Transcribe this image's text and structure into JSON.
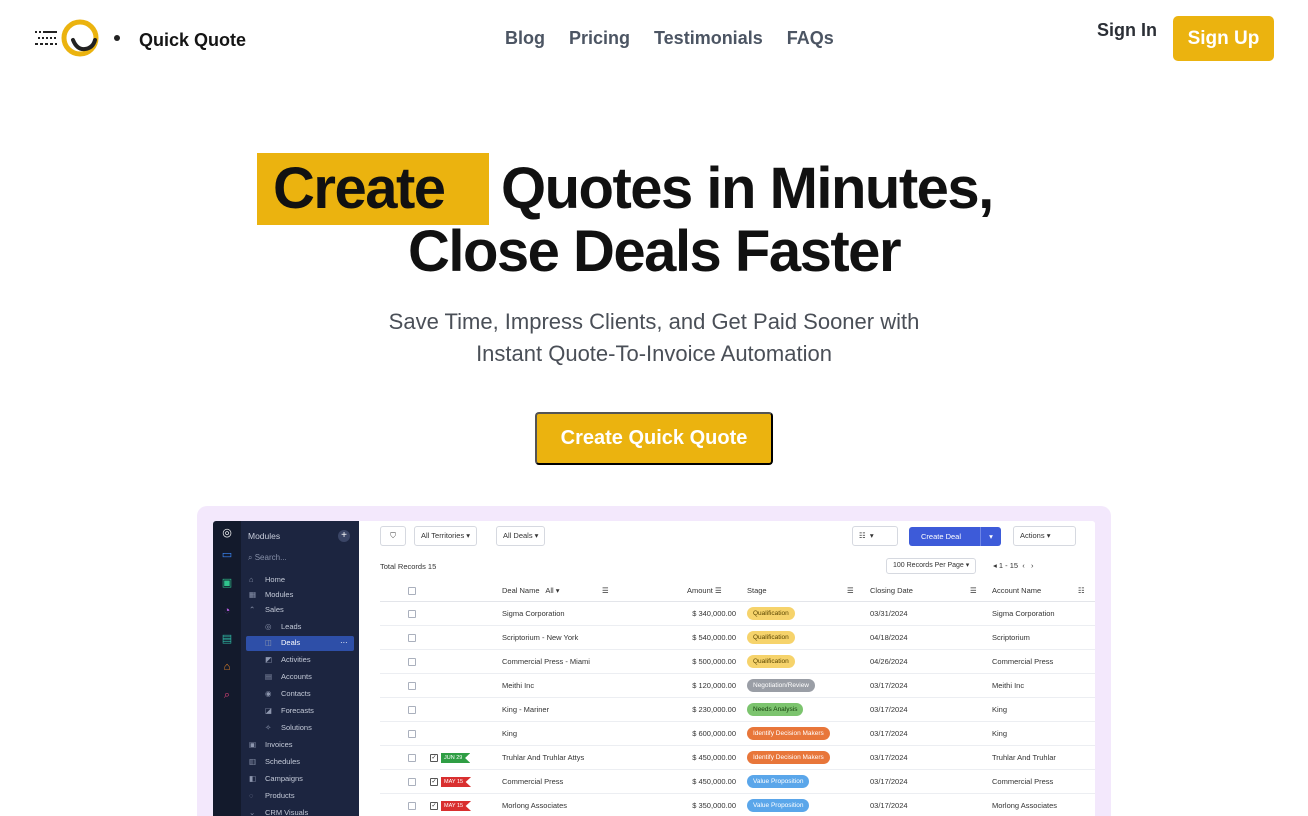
{
  "brand": {
    "name": "Quick Quote",
    "accent": "#ebb30f"
  },
  "nav": {
    "links": [
      "Blog",
      "Pricing",
      "Testimonials",
      "FAQs"
    ],
    "sign_in": "Sign In",
    "sign_up": "Sign Up"
  },
  "hero": {
    "highlight": "Create",
    "line1_rest": "Quotes in Minutes,",
    "line2": "Close Deals Faster",
    "subtitle_1": "Save Time, Impress Clients, and Get Paid Sooner with",
    "subtitle_2": "Instant Quote-To-Invoice Automation",
    "cta": "Create Quick Quote"
  },
  "app": {
    "sidebar": {
      "header": "Modules",
      "search": "Search...",
      "items": [
        {
          "icon": "home-icon",
          "glyph": "⌂",
          "label": "Home",
          "sub": false
        },
        {
          "icon": "modules-icon",
          "glyph": "▦",
          "label": "Modules",
          "sub": false
        },
        {
          "icon": "sales-icon",
          "glyph": "⌃",
          "label": "Sales",
          "sub": false
        },
        {
          "icon": "leads-icon",
          "glyph": "◎",
          "label": "Leads",
          "sub": true
        },
        {
          "icon": "deals-icon",
          "glyph": "◫",
          "label": "Deals",
          "sub": true
        },
        {
          "icon": "activities-icon",
          "glyph": "◩",
          "label": "Activities",
          "sub": true
        },
        {
          "icon": "accounts-icon",
          "glyph": "▤",
          "label": "Accounts",
          "sub": true
        },
        {
          "icon": "contacts-icon",
          "glyph": "◉",
          "label": "Contacts",
          "sub": true
        },
        {
          "icon": "forecasts-icon",
          "glyph": "◪",
          "label": "Forecasts",
          "sub": true
        },
        {
          "icon": "solutions-icon",
          "glyph": "✧",
          "label": "Solutions",
          "sub": true
        },
        {
          "icon": "invoices-icon",
          "glyph": "▣",
          "label": "Invoices",
          "sub": false
        },
        {
          "icon": "schedules-icon",
          "glyph": "▥",
          "label": "Schedules",
          "sub": false
        },
        {
          "icon": "campaigns-icon",
          "glyph": "◧",
          "label": "Campaigns",
          "sub": false
        },
        {
          "icon": "products-icon",
          "glyph": "◌",
          "label": "Products",
          "sub": false
        },
        {
          "icon": "crm-visuals-icon",
          "glyph": "⌄",
          "label": "CRM Visuals",
          "sub": false
        }
      ]
    },
    "toolbar": {
      "filter_icon": "filter-icon",
      "territories": "All Territories",
      "deals_filter": "All Deals",
      "create_deal": "Create Deal",
      "actions": "Actions"
    },
    "total_records": "Total Records 15",
    "per_page": "100 Records Per Page",
    "page_info": "1 - 15",
    "columns": {
      "deal_name": "Deal Name",
      "deal_filter": "All",
      "amount": "Amount",
      "stage": "Stage",
      "closing_date": "Closing Date",
      "account_name": "Account Name"
    },
    "rows": [
      {
        "deal": "Sigma Corporation",
        "amount": "$ 340,000.00",
        "stage": "Qualification",
        "stage_bg": "#f6d36b",
        "stage_fg": "#5a4500",
        "date": "03/31/2024",
        "account": "Sigma Corporation",
        "flag": "",
        "flag_color": ""
      },
      {
        "deal": "Scriptorium - New York",
        "amount": "$ 540,000.00",
        "stage": "Qualification",
        "stage_bg": "#f6d36b",
        "stage_fg": "#5a4500",
        "date": "04/18/2024",
        "account": "Scriptorium",
        "flag": "",
        "flag_color": ""
      },
      {
        "deal": "Commercial Press - Miami",
        "amount": "$ 500,000.00",
        "stage": "Qualification",
        "stage_bg": "#f6d36b",
        "stage_fg": "#5a4500",
        "date": "04/26/2024",
        "account": "Commercial Press",
        "flag": "",
        "flag_color": ""
      },
      {
        "deal": "Meithi Inc",
        "amount": "$ 120,000.00",
        "stage": "Negotiation/Review",
        "stage_bg": "#9a9ea6",
        "stage_fg": "#ffffff",
        "date": "03/17/2024",
        "account": "Meithi Inc",
        "flag": "",
        "flag_color": ""
      },
      {
        "deal": "King - Mariner",
        "amount": "$ 230,000.00",
        "stage": "Needs Analysis",
        "stage_bg": "#7cc46e",
        "stage_fg": "#17400f",
        "date": "03/17/2024",
        "account": "King",
        "flag": "",
        "flag_color": ""
      },
      {
        "deal": "King",
        "amount": "$ 600,000.00",
        "stage": "Identify Decision Makers",
        "stage_bg": "#e8763a",
        "stage_fg": "#ffffff",
        "date": "03/17/2024",
        "account": "King",
        "flag": "",
        "flag_color": ""
      },
      {
        "deal": "Truhlar And Truhlar Attys",
        "amount": "$ 450,000.00",
        "stage": "Identify Decision Makers",
        "stage_bg": "#e8763a",
        "stage_fg": "#ffffff",
        "date": "03/17/2024",
        "account": "Truhlar And Truhlar",
        "flag": "JUN 29",
        "flag_color": "#2f9e44"
      },
      {
        "deal": "Commercial Press",
        "amount": "$ 450,000.00",
        "stage": "Value Proposition",
        "stage_bg": "#5aa6ea",
        "stage_fg": "#ffffff",
        "date": "03/17/2024",
        "account": "Commercial Press",
        "flag": "MAY 15",
        "flag_color": "#d92f2f"
      },
      {
        "deal": "Morlong Associates",
        "amount": "$ 350,000.00",
        "stage": "Value Proposition",
        "stage_bg": "#5aa6ea",
        "stage_fg": "#ffffff",
        "date": "03/17/2024",
        "account": "Morlong Associates",
        "flag": "MAY 15",
        "flag_color": "#d92f2f"
      }
    ]
  }
}
